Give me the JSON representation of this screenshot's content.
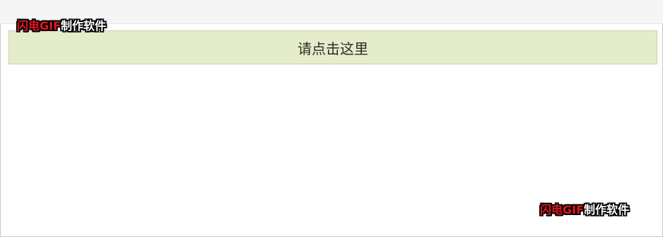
{
  "button": {
    "label": "请点击这里"
  },
  "watermark": {
    "red_part": "闪电GIF",
    "white_part": "制作软件"
  },
  "colors": {
    "button_background": "#e4ecca",
    "watermark_red": "#e8141c",
    "watermark_white": "#ffffff"
  }
}
